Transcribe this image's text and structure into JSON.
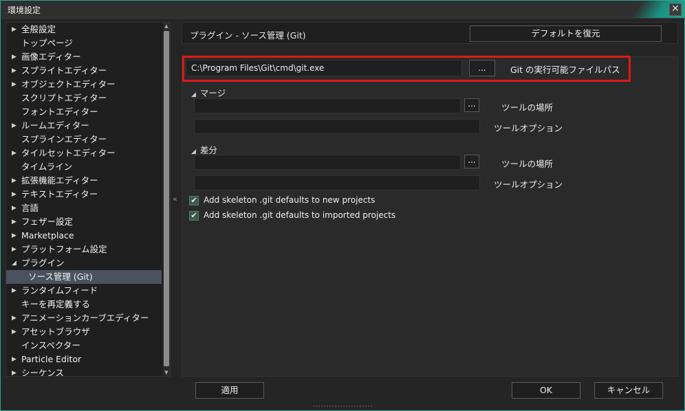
{
  "window": {
    "title": "環境設定",
    "close_label": "✕"
  },
  "tree": {
    "items": [
      {
        "label": "全般設定",
        "expandable": true
      },
      {
        "label": "トップページ",
        "expandable": false
      },
      {
        "label": "画像エディター",
        "expandable": true
      },
      {
        "label": "スプライトエディター",
        "expandable": true
      },
      {
        "label": "オブジェクトエディター",
        "expandable": true
      },
      {
        "label": "スクリプトエディター",
        "expandable": false
      },
      {
        "label": "フォントエディター",
        "expandable": false
      },
      {
        "label": "ルームエディター",
        "expandable": true
      },
      {
        "label": "スプラインエディター",
        "expandable": false
      },
      {
        "label": "タイルセットエディター",
        "expandable": true
      },
      {
        "label": "タイムライン",
        "expandable": false
      },
      {
        "label": "拡張機能エディター",
        "expandable": true
      },
      {
        "label": "テキストエディター",
        "expandable": true
      },
      {
        "label": "言語",
        "expandable": true
      },
      {
        "label": "フェザー設定",
        "expandable": true
      },
      {
        "label": "Marketplace",
        "expandable": true
      },
      {
        "label": "プラットフォーム設定",
        "expandable": true
      },
      {
        "label": "プラグイン",
        "expanded": true
      },
      {
        "label": "ソース管理 (Git)",
        "child": true,
        "selected": true
      },
      {
        "label": "ランタイムフィード",
        "expandable": true
      },
      {
        "label": "キーを再定義する",
        "expandable": false
      },
      {
        "label": "アニメーションカーブエディター",
        "expandable": true
      },
      {
        "label": "アセットブラウザ",
        "expandable": true
      },
      {
        "label": "インスペクター",
        "expandable": false
      },
      {
        "label": "Particle Editor",
        "expandable": true
      },
      {
        "label": "シーケンス",
        "expandable": true
      }
    ]
  },
  "collapse_label": "«",
  "panel": {
    "title": "プラグイン - ソース管理 (Git)",
    "reset_label": "デフォルトを復元",
    "git_path": {
      "value": "C:\\Program Files\\Git\\cmd\\git.exe",
      "browse": "...",
      "label": "Git の実行可能ファイルパス"
    },
    "merge": {
      "heading": "マージ",
      "tool_location": {
        "value": "",
        "browse": "...",
        "label": "ツールの場所"
      },
      "tool_options": {
        "value": "",
        "label": "ツールオプション"
      }
    },
    "diff": {
      "heading": "差分",
      "tool_location": {
        "value": "",
        "browse": "...",
        "label": "ツールの場所"
      },
      "tool_options": {
        "value": "",
        "label": "ツールオプション"
      }
    },
    "checkboxes": [
      {
        "label": "Add skeleton .git defaults to new projects",
        "checked": true
      },
      {
        "label": "Add skeleton .git defaults to imported projects",
        "checked": true
      }
    ]
  },
  "footer": {
    "apply_label": "適用",
    "ok_label": "OK",
    "cancel_label": "キャンセル"
  },
  "colors": {
    "accent": "#26a896",
    "highlight": "#e01818",
    "selected_row": "#4a5260"
  }
}
